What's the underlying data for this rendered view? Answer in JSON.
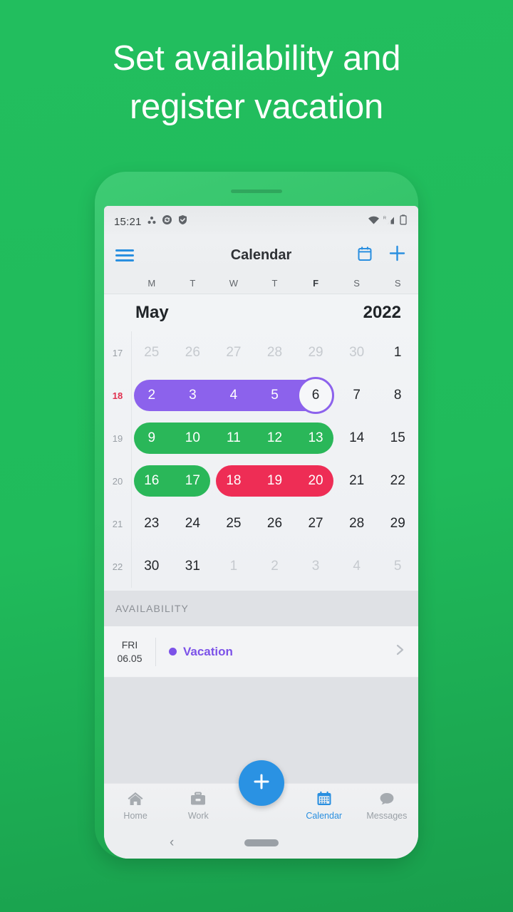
{
  "headline": {
    "line1": "Set availability and",
    "line2": "register vacation"
  },
  "colors": {
    "background_green": "#20bb5b",
    "phone_frame_green": "#2dbe62",
    "accent_blue": "#2a8fe0",
    "vacation_purple": "#8c62ec",
    "available_green": "#2ab759",
    "unavailable_red": "#ee2d55",
    "current_week_red": "#e0304e"
  },
  "status_bar": {
    "time": "15:21",
    "left_icons": [
      "dots-triangle-icon",
      "sync-icon",
      "shield-check-icon"
    ],
    "right_icons": [
      "wifi-icon",
      "roaming-signal-icon",
      "battery-icon"
    ]
  },
  "app_bar": {
    "menu_icon": "hamburger-menu-icon",
    "title": "Calendar",
    "actions": [
      {
        "icon": "calendar-outline-icon",
        "name": "today-button"
      },
      {
        "icon": "plus-icon",
        "name": "add-event-button"
      }
    ]
  },
  "weekdays": [
    {
      "label": "M",
      "bold": false
    },
    {
      "label": "T",
      "bold": false
    },
    {
      "label": "W",
      "bold": false
    },
    {
      "label": "T",
      "bold": false
    },
    {
      "label": "F",
      "bold": true
    },
    {
      "label": "S",
      "bold": false
    },
    {
      "label": "S",
      "bold": false
    }
  ],
  "calendar": {
    "month": "May",
    "year": "2022",
    "selected_day": "6",
    "weeks": [
      {
        "week_number": "17",
        "current": false,
        "days": [
          {
            "n": "25",
            "muted": true
          },
          {
            "n": "26",
            "muted": true
          },
          {
            "n": "27",
            "muted": true
          },
          {
            "n": "28",
            "muted": true
          },
          {
            "n": "29",
            "muted": true
          },
          {
            "n": "30",
            "muted": true
          },
          {
            "n": "1",
            "muted": false
          }
        ],
        "pills": []
      },
      {
        "week_number": "18",
        "current": true,
        "days": [
          {
            "n": "2",
            "muted": false,
            "on_pill": true
          },
          {
            "n": "3",
            "muted": false,
            "on_pill": true
          },
          {
            "n": "4",
            "muted": false,
            "on_pill": true
          },
          {
            "n": "5",
            "muted": false,
            "on_pill": true
          },
          {
            "n": "6",
            "muted": false,
            "on_pill": true,
            "selected": true
          },
          {
            "n": "7",
            "muted": false
          },
          {
            "n": "8",
            "muted": false
          }
        ],
        "pills": [
          {
            "type": "vacation",
            "color": "purple",
            "start": 0,
            "end": 4
          }
        ]
      },
      {
        "week_number": "19",
        "current": false,
        "days": [
          {
            "n": "9",
            "muted": false,
            "on_pill": true
          },
          {
            "n": "10",
            "muted": false,
            "on_pill": true
          },
          {
            "n": "11",
            "muted": false,
            "on_pill": true
          },
          {
            "n": "12",
            "muted": false,
            "on_pill": true
          },
          {
            "n": "13",
            "muted": false,
            "on_pill": true
          },
          {
            "n": "14",
            "muted": false
          },
          {
            "n": "15",
            "muted": false
          }
        ],
        "pills": [
          {
            "type": "available",
            "color": "green",
            "start": 0,
            "end": 4
          }
        ]
      },
      {
        "week_number": "20",
        "current": false,
        "days": [
          {
            "n": "16",
            "muted": false,
            "on_pill": true
          },
          {
            "n": "17",
            "muted": false,
            "on_pill": true
          },
          {
            "n": "18",
            "muted": false,
            "on_pill": true
          },
          {
            "n": "19",
            "muted": false,
            "on_pill": true
          },
          {
            "n": "20",
            "muted": false,
            "on_pill": true
          },
          {
            "n": "21",
            "muted": false
          },
          {
            "n": "22",
            "muted": false
          }
        ],
        "pills": [
          {
            "type": "available",
            "color": "green",
            "start": 0,
            "end": 1
          },
          {
            "type": "unavailable",
            "color": "red",
            "start": 2,
            "end": 4
          }
        ]
      },
      {
        "week_number": "21",
        "current": false,
        "days": [
          {
            "n": "23",
            "muted": false
          },
          {
            "n": "24",
            "muted": false
          },
          {
            "n": "25",
            "muted": false
          },
          {
            "n": "26",
            "muted": false
          },
          {
            "n": "27",
            "muted": false
          },
          {
            "n": "28",
            "muted": false
          },
          {
            "n": "29",
            "muted": false
          }
        ],
        "pills": []
      },
      {
        "week_number": "22",
        "current": false,
        "days": [
          {
            "n": "30",
            "muted": false
          },
          {
            "n": "31",
            "muted": false
          },
          {
            "n": "1",
            "muted": true
          },
          {
            "n": "2",
            "muted": true
          },
          {
            "n": "3",
            "muted": true
          },
          {
            "n": "4",
            "muted": true
          },
          {
            "n": "5",
            "muted": true
          }
        ],
        "pills": []
      }
    ]
  },
  "availability": {
    "section_title": "AVAILABILITY",
    "entries": [
      {
        "weekday": "FRI",
        "date": "06.05",
        "label": "Vacation",
        "dot_color": "#7c52e8",
        "chevron": "chevron-right-icon"
      }
    ]
  },
  "bottom_nav": {
    "items": [
      {
        "label": "Home",
        "icon": "home-icon",
        "active": false
      },
      {
        "label": "Work",
        "icon": "briefcase-icon",
        "active": false
      },
      {
        "label": "Calendar",
        "icon": "calendar-icon",
        "active": true
      },
      {
        "label": "Messages",
        "icon": "message-icon",
        "active": false
      }
    ],
    "fab": {
      "icon": "plus-icon",
      "name": "add-button"
    }
  },
  "system_nav": {
    "back": "back-chevron-icon",
    "home": "home-pill-indicator"
  }
}
